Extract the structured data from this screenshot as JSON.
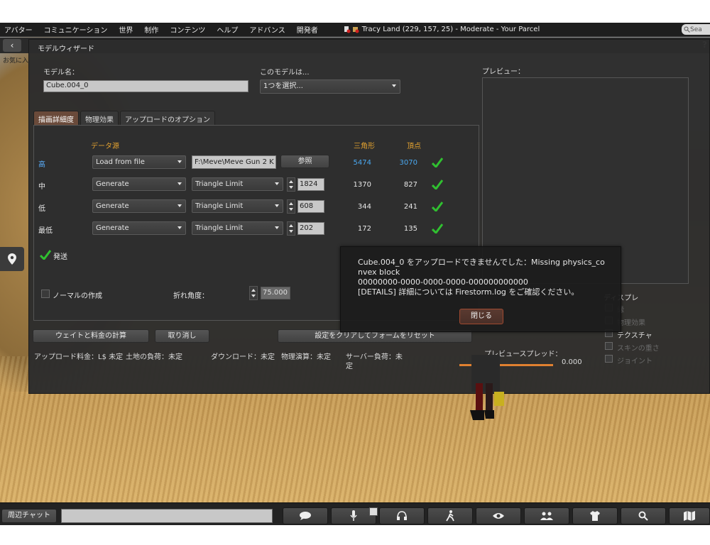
{
  "menubar": {
    "items": [
      "アバター",
      "コミュニケーション",
      "世界",
      "制作",
      "コンテンツ",
      "ヘルプ",
      "アドバンス",
      "開発者"
    ],
    "location": "Tracy Land (229, 157, 25) - Moderate - Your Parcel",
    "search_placeholder": "Sea"
  },
  "sidebar": {
    "favorites_label": "お気に入"
  },
  "wizard": {
    "title": "モデルウィザード",
    "model_name_label": "モデル名：",
    "model_name_value": "Cube.004_0",
    "model_type_label": "このモデルは...",
    "model_type_value": "1つを選択...",
    "preview_label": "プレビュー：",
    "tabs": [
      "描画詳細度",
      "物理効果",
      "アップロードのオプション"
    ],
    "headers": {
      "source": "データ源",
      "triangles": "三角形",
      "vertices": "頂点"
    },
    "rows": [
      {
        "label": "高",
        "source": "Load from file",
        "file": "F:\\Meve\\Meve Gun 2 K",
        "browse": "参照",
        "triangles": "5474",
        "vertices": "3070"
      },
      {
        "label": "中",
        "source": "Generate",
        "mode": "Triangle Limit",
        "limit": "1824",
        "triangles": "1370",
        "vertices": "827"
      },
      {
        "label": "低",
        "source": "Generate",
        "mode": "Triangle Limit",
        "limit": "608",
        "triangles": "344",
        "vertices": "241"
      },
      {
        "label": "最低",
        "source": "Generate",
        "mode": "Triangle Limit",
        "limit": "202",
        "triangles": "172",
        "vertices": "135"
      }
    ],
    "status_text": "発送",
    "normals_label": "ノーマルの作成",
    "crease_label": "折れ角度：",
    "crease_value": "75.000",
    "calc_button": "ウェイトと料金の計算",
    "cancel_button": "取り消し",
    "reset_button": "設定をクリアしてフォームをリセット",
    "fees": {
      "upload": "アップロード料金：L$ 未定",
      "land": "土地の負荷：未定",
      "download": "ダウンロード：未定",
      "physics": "物理演算：未定",
      "server": "サーバー負荷：未",
      "server2": "定"
    },
    "preview_spread_label": "プレビュースプレッド：",
    "preview_spread_value": "0.000"
  },
  "display": {
    "label": "ディスプレ",
    "options": [
      "縁",
      "物理効果",
      "テクスチャ",
      "スキンの重さ",
      "ジョイント"
    ]
  },
  "toast": {
    "message": "Cube.004_0 をアップロードできませんでした：Missing physics_convex block\n00000000-0000-0000-0000-000000000000\n[DETAILS] 詳細については Firestorm.log をご確認ください。",
    "close_button": "閉じる"
  },
  "bottombar": {
    "nearby_chat": "周辺チャット"
  },
  "colors": {
    "accent_orange": "#e0a030",
    "check_green": "#30c030",
    "high_blue": "#4aa8f0"
  }
}
